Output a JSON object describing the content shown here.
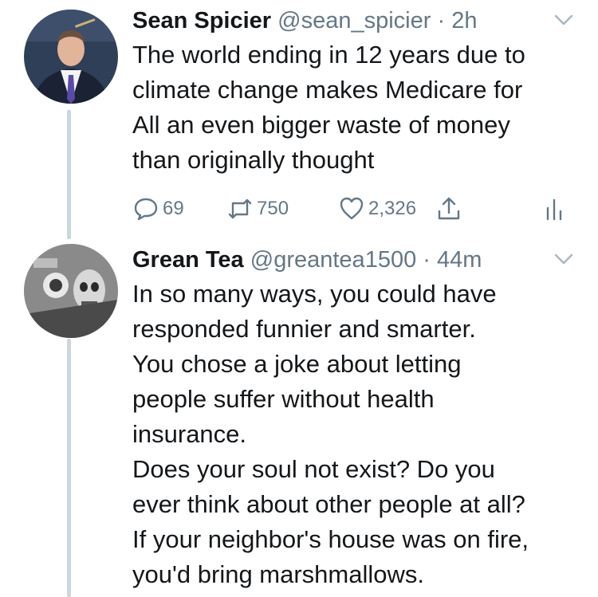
{
  "tweets": [
    {
      "author": {
        "name": "Sean Spicier",
        "handle": "@sean_spicier"
      },
      "separator": "·",
      "time": "2h",
      "text_lines": [
        "The world ending in 12 years due to",
        "climate change makes Medicare for",
        "All an even bigger waste of money",
        "than originally thought"
      ],
      "actions": {
        "replies": "69",
        "retweets": "750",
        "likes": "2,326"
      },
      "icons": [
        "reply-icon",
        "retweet-icon",
        "heart-icon",
        "share-icon",
        "analytics-icon",
        "chevron-down-icon"
      ]
    },
    {
      "author": {
        "name": "Grean Tea",
        "handle": "@greantea1500"
      },
      "separator": "·",
      "time": "44m",
      "text_lines": [
        "In so many ways, you could have",
        "responded funnier and smarter.",
        "You chose a joke about letting",
        "people suffer without health",
        "insurance.",
        "Does your soul not exist? Do you",
        "ever think about other people at all?",
        "If your neighbor's house was on fire,",
        "you'd bring marshmallows."
      ],
      "icons": [
        "chevron-down-icon"
      ]
    }
  ],
  "colors": {
    "text": "#14171a",
    "secondary": "#657786",
    "thread_line": "#ccd6dd"
  }
}
